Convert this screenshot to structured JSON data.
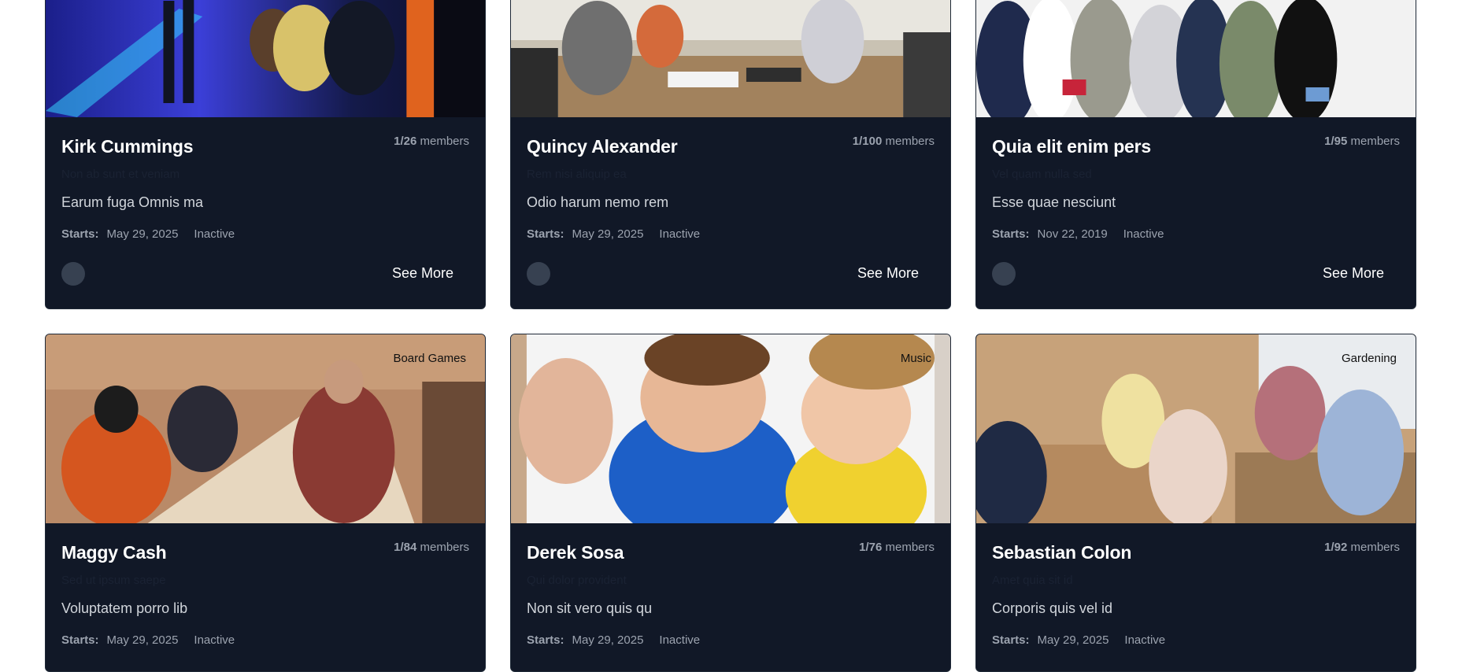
{
  "cards": [
    {
      "title": "Kirk Cummings",
      "members_count": "1/26",
      "members_label": "members",
      "subtitle": "Non ab sunt et veniam",
      "description": "Earum fuga Omnis ma",
      "starts_label": "Starts:",
      "start_date": "May 29, 2025",
      "status": "Inactive",
      "cta": "See More"
    },
    {
      "title": "Quincy Alexander",
      "members_count": "1/100",
      "members_label": "members",
      "subtitle": "Rem nisi aliquip ea",
      "description": "Odio harum nemo rem",
      "starts_label": "Starts:",
      "start_date": "May 29, 2025",
      "status": "Inactive",
      "cta": "See More"
    },
    {
      "title": "Quia elit enim pers",
      "members_count": "1/95",
      "members_label": "members",
      "subtitle": "Vel quam nulla sed",
      "description": "Esse quae nesciunt",
      "starts_label": "Starts:",
      "start_date": "Nov 22, 2019",
      "status": "Inactive",
      "cta": "See More"
    },
    {
      "category": "Board Games",
      "title": "Maggy Cash",
      "members_count": "1/84",
      "members_label": "members",
      "subtitle": "Sed ut ipsum saepe",
      "description": "Voluptatem porro lib",
      "starts_label": "Starts:",
      "start_date": "May 29, 2025",
      "status": "Inactive"
    },
    {
      "category": "Music",
      "title": "Derek Sosa",
      "members_count": "1/76",
      "members_label": "members",
      "subtitle": "Qui dolor provident",
      "description": "Non sit vero quis qu",
      "starts_label": "Starts:",
      "start_date": "May 29, 2025",
      "status": "Inactive"
    },
    {
      "category": "Gardening",
      "title": "Sebastian Colon",
      "members_count": "1/92",
      "members_label": "members",
      "subtitle": "Amet quia sit id",
      "description": "Corporis quis vel id",
      "starts_label": "Starts:",
      "start_date": "May 29, 2025",
      "status": "Inactive"
    }
  ],
  "colors": {
    "card_bg": "#111827",
    "page_bg": "#ffffff",
    "muted_text": "#9ca3af",
    "avatar": "#374151"
  }
}
